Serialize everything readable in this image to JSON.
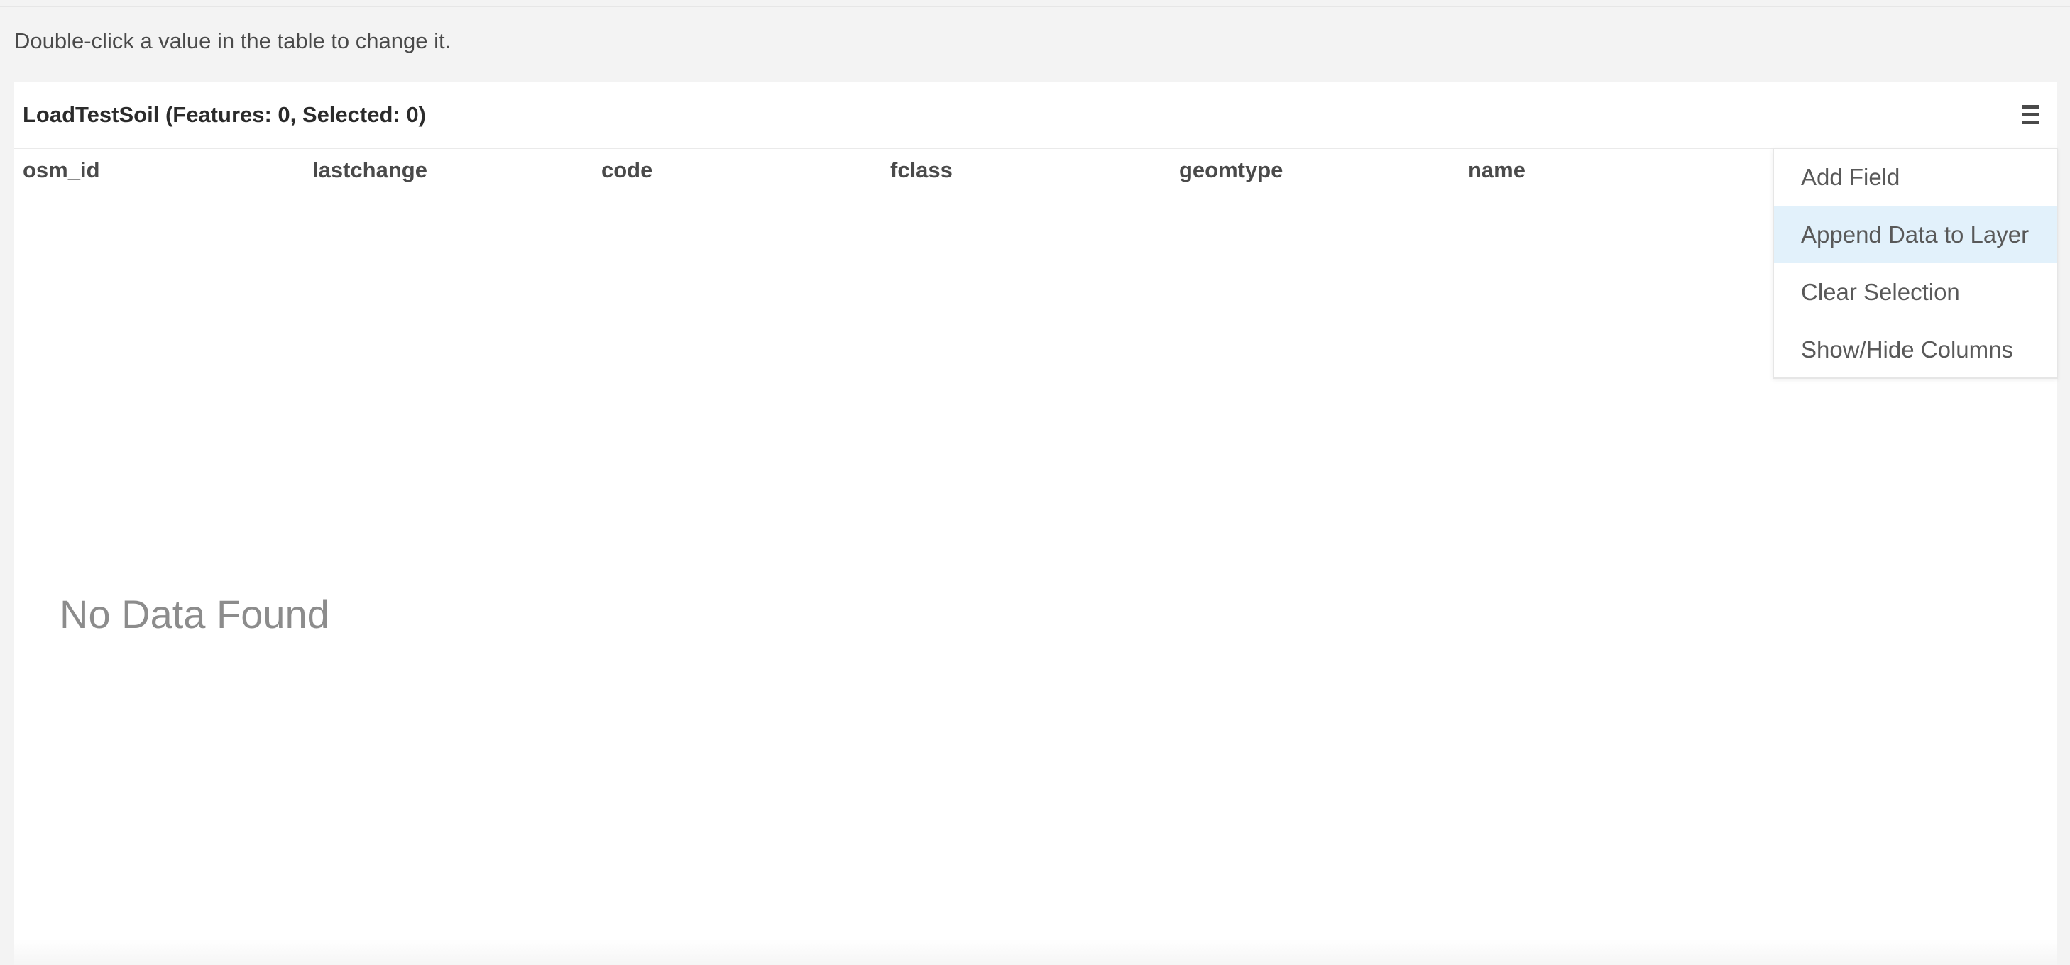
{
  "instruction": "Double-click a value in the table to change it.",
  "panel": {
    "title": "LoadTestSoil (Features: 0, Selected: 0)",
    "menu_icon": "hamburger-menu-icon"
  },
  "table": {
    "columns": [
      "osm_id",
      "lastchange",
      "code",
      "fclass",
      "geomtype",
      "name"
    ],
    "empty_message": "No Data Found"
  },
  "menu": {
    "items": [
      "Add Field",
      "Append Data to Layer",
      "Clear Selection",
      "Show/Hide Columns"
    ],
    "highlighted_item": "Append Data to Layer",
    "highlight_color": "#e2f1fb"
  }
}
